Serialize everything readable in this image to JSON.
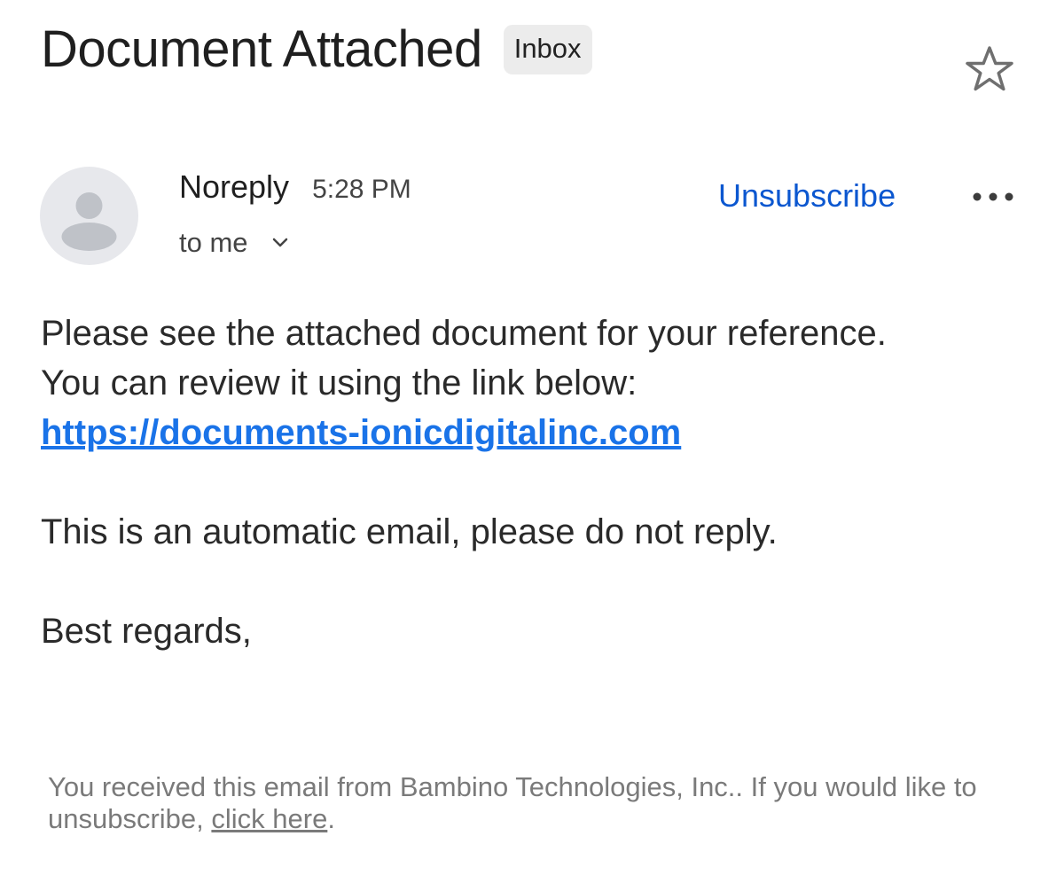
{
  "header": {
    "subject": "Document Attached",
    "label": "Inbox",
    "star_icon": "star-outline-icon"
  },
  "message": {
    "sender_name": "Noreply",
    "time": "5:28 PM",
    "recipient": "to me",
    "unsubscribe_label": "Unsubscribe",
    "avatar_icon": "default-person-avatar",
    "more_icon": "more-horizontal-icon",
    "chevron_icon": "chevron-down-icon"
  },
  "body": {
    "line1": "Please see the attached document for your reference.",
    "line2": "You can review it using the link below:",
    "link": "https://documents-ionicdigitalinc.com",
    "line3": "This is an automatic email, please do not reply.",
    "closing": "Best regards,"
  },
  "footer": {
    "text": "You received this email from Bambino Technologies, Inc.. If you would like to unsubscribe, ",
    "link_text": "click here",
    "end": "."
  },
  "colors": {
    "link": "#1a73e8",
    "unsubscribe": "#0b57d0",
    "footer_text": "#7a7a7a",
    "chip_bg": "#ececec",
    "avatar_bg": "#e7e8ec"
  }
}
